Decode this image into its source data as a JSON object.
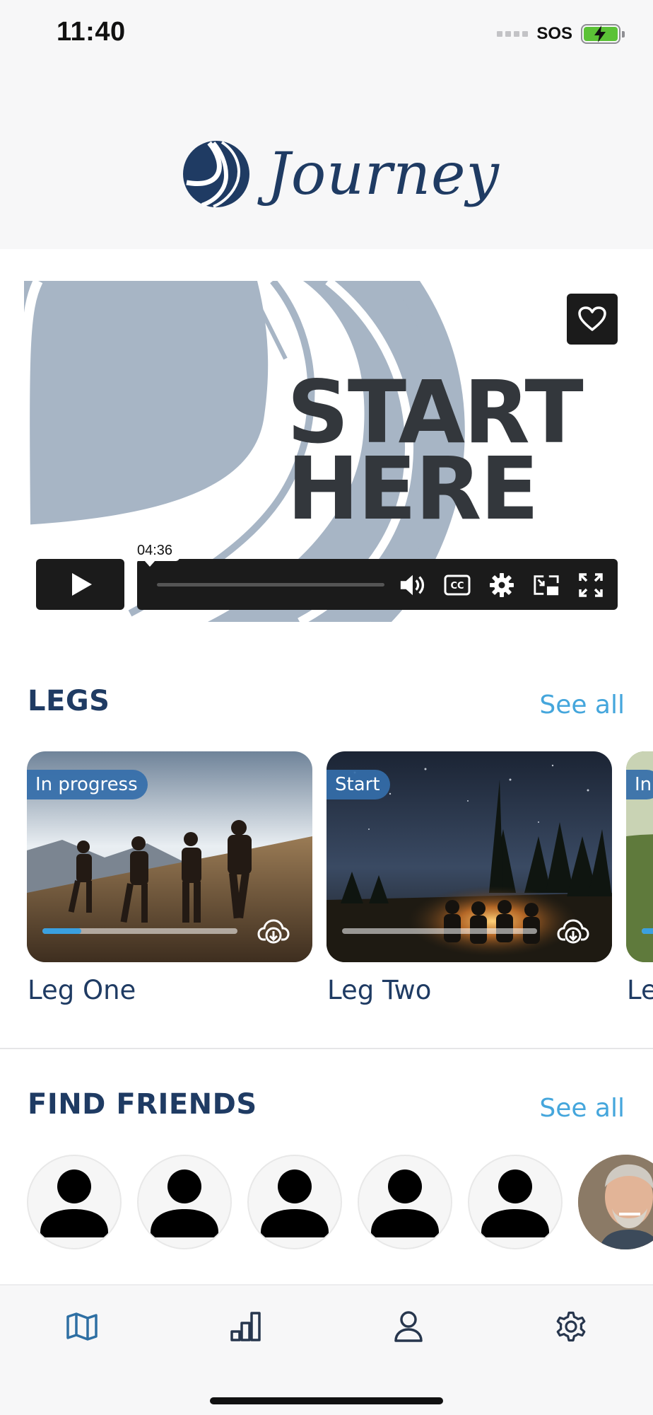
{
  "status": {
    "time": "11:40",
    "carrier": "SOS"
  },
  "header": {
    "brand": "Journey"
  },
  "video": {
    "line1": "START",
    "line2": "HERE",
    "duration": "04:36",
    "progress": 0
  },
  "legs": {
    "title": "LEGS",
    "see_all": "See all",
    "items": [
      {
        "name": "Leg One",
        "badge": "In progress",
        "progress": 0.2
      },
      {
        "name": "Leg Two",
        "badge": "Start",
        "progress": 0
      },
      {
        "name": "Le",
        "badge": "In"
      }
    ]
  },
  "friends": {
    "title": "FIND FRIENDS",
    "see_all": "See all"
  },
  "tabbar": {
    "items": [
      "map-icon",
      "stats-icon",
      "profile-icon",
      "settings-icon"
    ]
  },
  "colors": {
    "brand": "#1f3b63",
    "accent": "#45a6dc",
    "progress": "#3aa0e0"
  }
}
